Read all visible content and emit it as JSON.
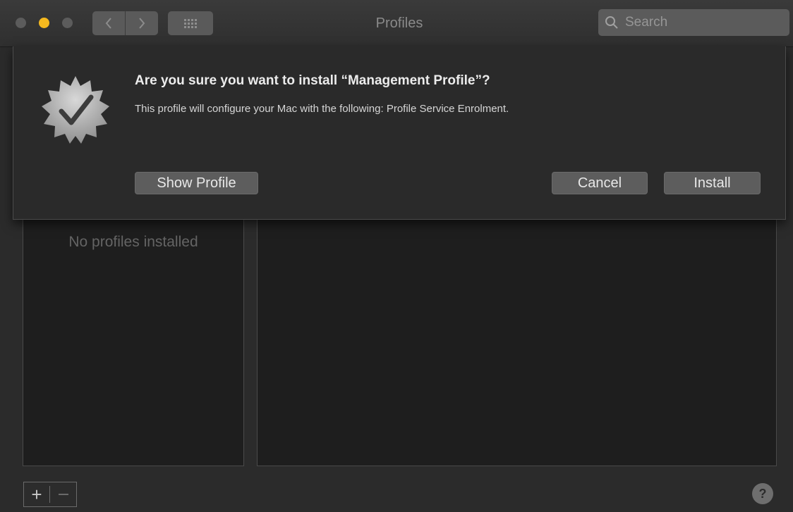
{
  "window": {
    "title": "Profiles",
    "search_placeholder": "Search"
  },
  "toolbar": {
    "back_icon": "chevron-left-icon",
    "forward_icon": "chevron-right-icon",
    "show_all_icon": "grid-icon"
  },
  "dialog": {
    "heading": "Are you sure you want to install “Management Profile”?",
    "message": "This profile will configure your Mac with the following: Profile Service Enrolment.",
    "show_profile_label": "Show Profile",
    "cancel_label": "Cancel",
    "install_label": "Install",
    "badge_icon": "verified-badge-icon"
  },
  "profiles": {
    "empty_text": "No profiles installed",
    "add_label": "+",
    "help_label": "?"
  },
  "colors": {
    "accent_yellow": "#f5b91f",
    "window_bg": "#2b2b2b",
    "pane_bg": "#1e1e1e"
  }
}
